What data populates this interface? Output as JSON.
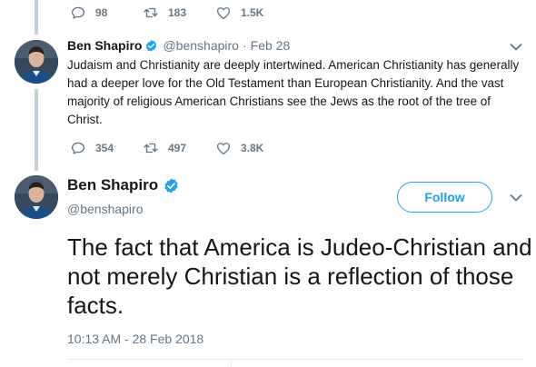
{
  "top_actions": {
    "replies": "98",
    "retweets": "183",
    "likes": "1.5K"
  },
  "reply_tweet": {
    "name": "Ben Shapiro",
    "handle": "@benshapiro",
    "separator": "·",
    "date": "Feb 28",
    "text": "Judaism and Christianity are deeply intertwined. American Christianity has generally had a deeper love for the Old Testament than European Christianity. And the vast majority of religious American Christians see the Jews as the root of the tree of Christ.",
    "replies": "354",
    "retweets": "497",
    "likes": "3.8K"
  },
  "main_tweet": {
    "name": "Ben Shapiro",
    "handle": "@benshapiro",
    "follow_label": "Follow",
    "text": "The fact that America is Judeo-Christian and not merely Christian is a reflection of those facts.",
    "timestamp": "10:13 AM - 28 Feb 2018"
  },
  "colors": {
    "accent": "#1da1f2",
    "muted": "#657786",
    "text": "#14171a",
    "thread_line": "#c4cfd6"
  },
  "icons": [
    "reply-icon",
    "retweet-icon",
    "like-icon",
    "verified-badge-icon",
    "chevron-down-icon"
  ]
}
